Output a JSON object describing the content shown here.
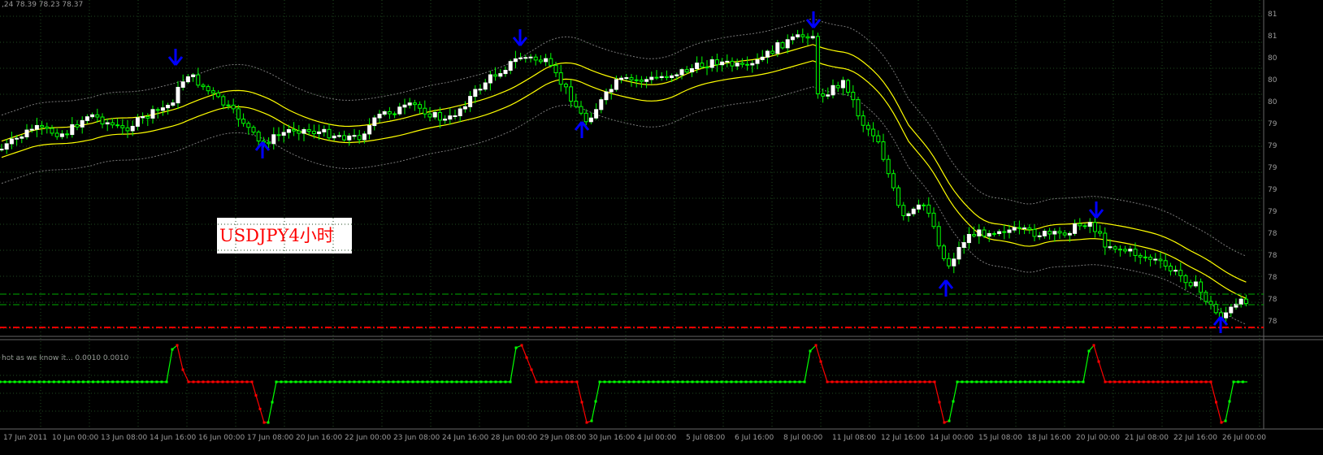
{
  "header": {
    "ohlc_text": ",24 78.39 78.23 78.37"
  },
  "annotation": {
    "label": "USDJPY4小时"
  },
  "indicator": {
    "title": "hot as we know it...  0.0010 0.0010"
  },
  "colors": {
    "background": "#000000",
    "grid": "#1f4a1f",
    "bull_candle": "#ffffff",
    "bear_candle": "#00ff00",
    "wick": "#00ff00",
    "moving_average": "#ffff00",
    "envelope": "#7a7a7a",
    "arrows": "#0000ff",
    "level_lines": "#00aa00",
    "red_level": "#ff0000",
    "indicator_up": "#00ff00",
    "indicator_down": "#ff0000"
  },
  "time_axis": {
    "labels": [
      "17 Jun 2011",
      "10 Jun 00:00",
      "13 Jun 08:00",
      "14 Jun 16:00",
      "16 Jun 00:00",
      "17 Jun 08:00",
      "20 Jun 16:00",
      "22 Jun 00:00",
      "23 Jun 08:00",
      "24 Jun 16:00",
      "28 Jun 00:00",
      "29 Jun 08:00",
      "30 Jun 16:00",
      "4 Jul 00:00",
      "5 Jul 08:00",
      "6 Jul 16:00",
      "8 Jul 00:00",
      "11 Jul 08:00",
      "12 Jul 16:00",
      "14 Jul 00:00",
      "15 Jul 08:00",
      "18 Jul 16:00",
      "20 Jul 00:00",
      "21 Jul 08:00",
      "22 Jul 16:00",
      "26 Jul 00:00"
    ]
  },
  "price_axis": {
    "labels": [
      "81",
      "81",
      "80",
      "80",
      "80",
      "79",
      "79",
      "79",
      "79",
      "79",
      "78",
      "78",
      "78",
      "78",
      "78"
    ]
  }
}
